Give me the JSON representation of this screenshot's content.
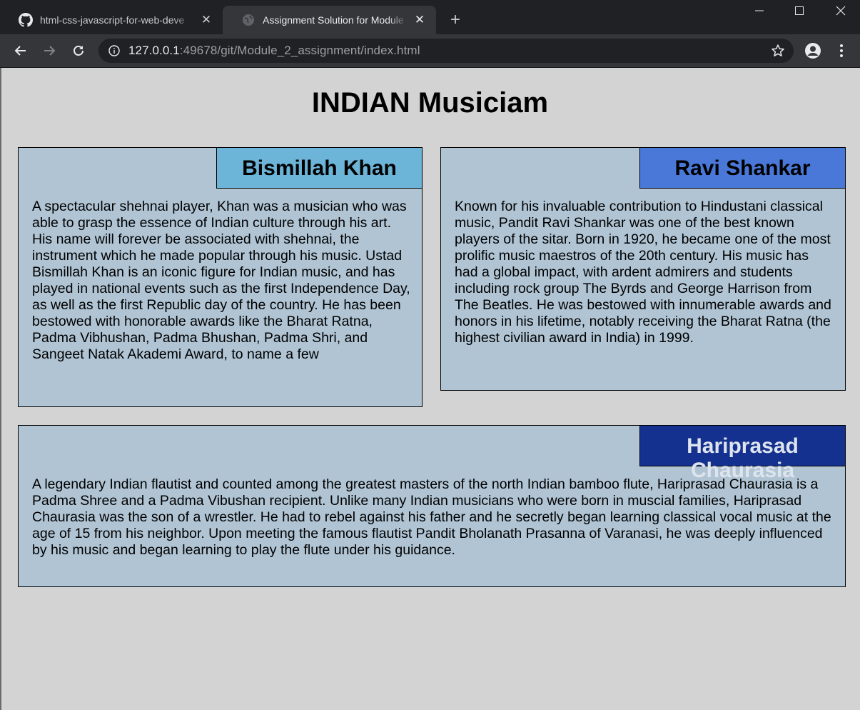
{
  "browser": {
    "tabs": [
      {
        "title": "html-css-javascript-for-web-deve",
        "icon": "github-icon"
      },
      {
        "title": "Assignment Solution for Module",
        "icon": "globe-icon"
      }
    ],
    "url_host": "127.0.0.1",
    "url_rest": ":49678/git/Module_2_assignment/index.html"
  },
  "page": {
    "title": "INDIAN Musiciam",
    "sections": [
      {
        "heading": "Bismillah Khan",
        "color": "#6cb4d8",
        "text": "A spectacular shehnai player, Khan was a musician who was able to grasp the essence of Indian culture through his art. His name will forever be associated with shehnai, the instrument which he made popular through his music. Ustad Bismillah Khan is an iconic figure for Indian music, and has played in national events such as the first Independence Day, as well as the first Republic day of the country. He has been bestowed with honorable awards like the Bharat Ratna, Padma Vibhushan, Padma Bhushan, Padma Shri, and Sangeet Natak Akademi Award, to name a few"
      },
      {
        "heading": "Ravi Shankar",
        "color": "#4a78d8",
        "text": "Known for his invaluable contribution to Hindustani classical music, Pandit Ravi Shankar was one of the best known players of the sitar. Born in 1920, he became one of the most prolific music maestros of the 20th century. His music has had a global impact, with ardent admirers and students including rock group The Byrds and George Harrison from The Beatles. He was bestowed with innumerable awards and honors in his lifetime, notably receiving the Bharat Ratna (the highest civilian award in India) in 1999."
      },
      {
        "heading": "Hariprasad Chaurasia",
        "color": "#14318f",
        "text": "A legendary Indian flautist and counted among the greatest masters of the north Indian bamboo flute, Hariprasad Chaurasia is a Padma Shree and a Padma Vibushan recipient. Unlike many Indian musicians who were born in muscial families, Hariprasad Chaurasia was the son of a wrestler. He had to rebel against his father and he secretly began learning classical vocal music at the age of 15 from his neighbor. Upon meeting the famous flautist Pandit Bholanath Prasanna of Varanasi, he was deeply influenced by his music and began learning to play the flute under his guidance."
      }
    ]
  }
}
